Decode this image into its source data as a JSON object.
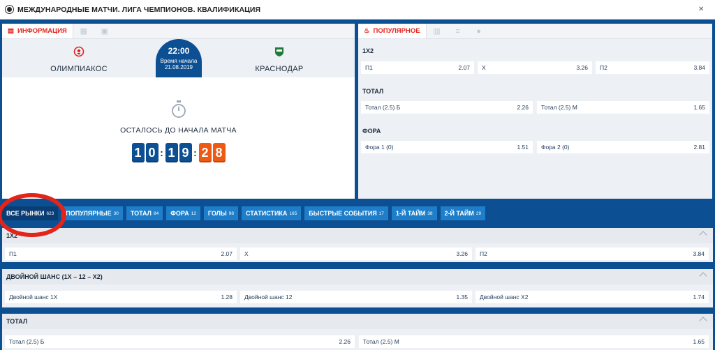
{
  "header": {
    "title": "МЕЖДУНАРОДНЫЕ МАТЧИ. ЛИГА ЧЕМПИОНОВ. КВАЛИФИКАЦИЯ"
  },
  "info": {
    "tab_label": "ИНФОРМАЦИЯ",
    "team1": "ОЛИМПИАКОС",
    "team2": "КРАСНОДАР",
    "time": "22:00",
    "time_label": "Время начала",
    "date": "21.08.2019",
    "countdown_label": "ОСТАЛОСЬ ДО НАЧАЛА МАТЧА",
    "digits": [
      "1",
      "0",
      "1",
      "9",
      "2",
      "8"
    ]
  },
  "popular": {
    "tab_label": "ПОПУЛЯРНОЕ",
    "s1": {
      "title": "1X2",
      "o1": {
        "label": "П1",
        "value": "2.07"
      },
      "o2": {
        "label": "Х",
        "value": "3.26"
      },
      "o3": {
        "label": "П2",
        "value": "3.84"
      }
    },
    "s2": {
      "title": "ТОТАЛ",
      "o1": {
        "label": "Тотал (2.5) Б",
        "value": "2.26"
      },
      "o2": {
        "label": "Тотал (2.5) М",
        "value": "1.65"
      }
    },
    "s3": {
      "title": "ФОРА",
      "o1": {
        "label": "Фора 1 (0)",
        "value": "1.51"
      },
      "o2": {
        "label": "Фора 2 (0)",
        "value": "2.81"
      }
    }
  },
  "market_tabs": [
    {
      "label": "ВСЕ РЫНКИ",
      "count": "623"
    },
    {
      "label": "ПОПУЛЯРНЫЕ",
      "count": "30"
    },
    {
      "label": "ТОТАЛ",
      "count": "84"
    },
    {
      "label": "ФОРА",
      "count": "12"
    },
    {
      "label": "ГОЛЫ",
      "count": "98"
    },
    {
      "label": "СТАТИСТИКА",
      "count": "165"
    },
    {
      "label": "БЫСТРЫЕ СОБЫТИЯ",
      "count": "17"
    },
    {
      "label": "1-Й ТАЙМ",
      "count": "38"
    },
    {
      "label": "2-Й ТАЙМ",
      "count": "29"
    }
  ],
  "bands": {
    "b1": {
      "title": "1X2",
      "o1": {
        "label": "П1",
        "value": "2.07"
      },
      "o2": {
        "label": "Х",
        "value": "3.26"
      },
      "o3": {
        "label": "П2",
        "value": "3.84"
      }
    },
    "b2": {
      "title": "ДВОЙНОЙ ШАНС (1X – 12 – X2)",
      "o1": {
        "label": "Двойной шанс 1X",
        "value": "1.28"
      },
      "o2": {
        "label": "Двойной шанс 12",
        "value": "1.35"
      },
      "o3": {
        "label": "Двойной шанс X2",
        "value": "1.74"
      }
    },
    "b3": {
      "title": "ТОТАЛ",
      "o1": {
        "label": "Тотал (2.5) Б",
        "value": "2.26"
      },
      "o2": {
        "label": "Тотал (2.5) М",
        "value": "1.65"
      }
    }
  },
  "colors": {
    "primary": "#0d4f93",
    "tab": "#1f7ec9",
    "accent_red": "#e2241b",
    "countdown_orange": "#ee5a13"
  }
}
